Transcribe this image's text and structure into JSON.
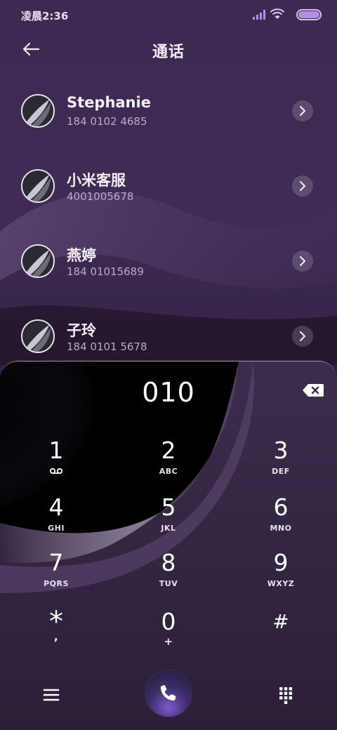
{
  "status_bar": {
    "time": "凌晨2:36",
    "battery_color": "#b48ee6"
  },
  "header": {
    "title": "通话",
    "back_icon": "arrow-left-icon"
  },
  "contacts": [
    {
      "name": "Stephanie",
      "number": "184 0102 4685"
    },
    {
      "name": "小米客服",
      "number": "4001005678"
    },
    {
      "name": "燕婷",
      "number": "184 01015689"
    },
    {
      "name": "子玲",
      "number": "184 0101 5678"
    }
  ],
  "dialer": {
    "display": "010",
    "delete_icon": "backspace-icon",
    "keys": [
      {
        "digit": "1",
        "letters": ""
      },
      {
        "digit": "2",
        "letters": "ABC"
      },
      {
        "digit": "3",
        "letters": "DEF"
      },
      {
        "digit": "4",
        "letters": "GHI"
      },
      {
        "digit": "5",
        "letters": "JKL"
      },
      {
        "digit": "6",
        "letters": "MNO"
      },
      {
        "digit": "7",
        "letters": "PQRS"
      },
      {
        "digit": "8",
        "letters": "TUV"
      },
      {
        "digit": "9",
        "letters": "WXYZ"
      },
      {
        "digit": "*",
        "letters": ","
      },
      {
        "digit": "0",
        "letters": "+"
      },
      {
        "digit": "#",
        "letters": ""
      }
    ],
    "key1_sub_icon": "voicemail-icon"
  },
  "bottom_bar": {
    "menu_icon": "menu-icon",
    "call_icon": "phone-icon",
    "keypad_icon": "dialpad-icon",
    "accent": "#7b59c8"
  }
}
